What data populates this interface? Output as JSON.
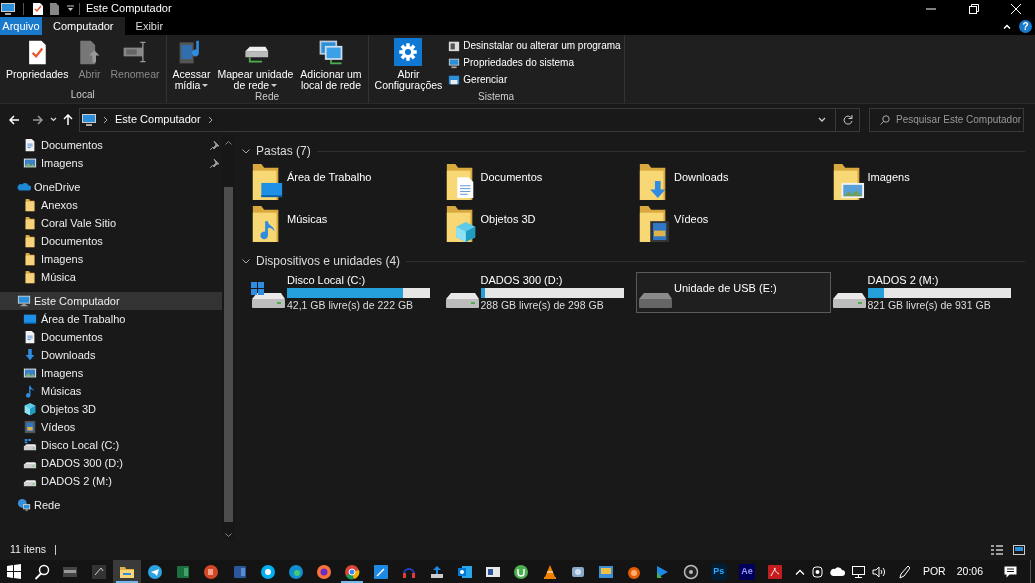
{
  "window": {
    "title": "Este Computador",
    "help": "?"
  },
  "tabs": [
    {
      "label": "Arquivo",
      "kind": "file",
      "selected": false
    },
    {
      "label": "Computador",
      "kind": "tab",
      "selected": true
    },
    {
      "label": "Exibir",
      "kind": "tab",
      "selected": false
    }
  ],
  "ribbon": {
    "groups": [
      {
        "label": "Local",
        "buttons": [
          {
            "kind": "properties",
            "lines": [
              "Propriedades"
            ],
            "disabled": false,
            "dropdown": false
          },
          {
            "kind": "open",
            "lines": [
              "Abrir"
            ],
            "disabled": true,
            "dropdown": false
          },
          {
            "kind": "rename",
            "lines": [
              "Renomear"
            ],
            "disabled": true,
            "dropdown": false
          }
        ]
      },
      {
        "label": "Rede",
        "buttons": [
          {
            "kind": "media",
            "lines": [
              "Acessar",
              "mídia"
            ],
            "disabled": false,
            "dropdown": true
          },
          {
            "kind": "map-drive",
            "lines": [
              "Mapear unidade",
              "de rede"
            ],
            "disabled": false,
            "dropdown": true
          },
          {
            "kind": "add-location",
            "lines": [
              "Adicionar um",
              "local de rede"
            ],
            "disabled": false,
            "dropdown": false
          }
        ]
      },
      {
        "label": "Sistema",
        "buttons": [
          {
            "kind": "settings",
            "lines": [
              "Abrir",
              "Configurações"
            ],
            "disabled": false,
            "dropdown": false
          }
        ],
        "small_buttons": [
          {
            "kind": "uninstall",
            "label": "Desinstalar ou alterar um programa"
          },
          {
            "kind": "system",
            "label": "Propriedades do sistema"
          },
          {
            "kind": "manage",
            "label": "Gerenciar"
          }
        ]
      }
    ]
  },
  "address": {
    "path": [
      "Este Computador"
    ],
    "search_placeholder": "Pesquisar Este Computador"
  },
  "nav": {
    "quick_access": [
      {
        "kind": "documents",
        "label": "Documentos",
        "pinned": true,
        "selected": false
      },
      {
        "kind": "pictures",
        "label": "Imagens",
        "pinned": true,
        "selected": false
      }
    ],
    "sections": [
      {
        "kind": "onedrive",
        "label": "OneDrive",
        "selected": false,
        "children": [
          {
            "kind": "folder",
            "label": "Anexos",
            "selected": false
          },
          {
            "kind": "folder",
            "label": "Coral Vale Sitio",
            "selected": false
          },
          {
            "kind": "folder",
            "label": "Documentos",
            "selected": false
          },
          {
            "kind": "folder",
            "label": "Imagens",
            "selected": false
          },
          {
            "kind": "folder",
            "label": "Música",
            "selected": false
          }
        ]
      },
      {
        "kind": "computer",
        "label": "Este Computador",
        "selected": true,
        "children": [
          {
            "kind": "desktop",
            "label": "Área de Trabalho",
            "selected": false
          },
          {
            "kind": "documents",
            "label": "Documentos",
            "selected": false
          },
          {
            "kind": "downloads",
            "label": "Downloads",
            "selected": false
          },
          {
            "kind": "pictures",
            "label": "Imagens",
            "selected": false
          },
          {
            "kind": "music",
            "label": "Músicas",
            "selected": false
          },
          {
            "kind": "objects3d",
            "label": "Objetos 3D",
            "selected": false
          },
          {
            "kind": "videos",
            "label": "Vídeos",
            "selected": false
          },
          {
            "kind": "windows-drive",
            "label": "Disco Local (C:)",
            "selected": false
          },
          {
            "kind": "drive",
            "label": "DADOS 300 (D:)",
            "selected": false
          },
          {
            "kind": "drive",
            "label": "DADOS 2 (M:)",
            "selected": false
          }
        ]
      },
      {
        "kind": "network",
        "label": "Rede",
        "selected": false
      }
    ]
  },
  "content": {
    "groups": [
      {
        "title": "Pastas (7)",
        "kind": "folders",
        "expanded": true,
        "items": [
          {
            "kind": "desktop",
            "label": "Área de Trabalho"
          },
          {
            "kind": "documents",
            "label": "Documentos"
          },
          {
            "kind": "downloads",
            "label": "Downloads"
          },
          {
            "kind": "pictures",
            "label": "Imagens"
          },
          {
            "kind": "music",
            "label": "Músicas"
          },
          {
            "kind": "objects3d",
            "label": "Objetos 3D"
          },
          {
            "kind": "videos",
            "label": "Vídeos"
          }
        ]
      },
      {
        "title": "Dispositivos e unidades (4)",
        "kind": "drives",
        "expanded": true,
        "items": [
          {
            "kind": "windows-drive",
            "label": "Disco Local (C:)",
            "level": 0.81,
            "reading": "42,1 GB livre(s) de 222 GB",
            "selected": false
          },
          {
            "kind": "drive",
            "label": "DADOS 300 (D:)",
            "level": 0.034,
            "reading": "288 GB livre(s) de 298 GB",
            "selected": false
          },
          {
            "kind": "usb",
            "label": "Unidade de USB (E:)",
            "selected": true
          },
          {
            "kind": "drive",
            "label": "DADOS 2 (M:)",
            "level": 0.118,
            "reading": "821 GB livre(s) de 931 GB",
            "selected": false
          }
        ]
      }
    ]
  },
  "status_bar": {
    "count": "11 itens"
  },
  "taskbar": {
    "apps": [
      {
        "kind": "start",
        "active": false,
        "running": false
      },
      {
        "kind": "search",
        "active": false,
        "running": false
      },
      {
        "kind": "dark",
        "active": false,
        "running": false
      },
      {
        "kind": "dark2",
        "active": false,
        "running": false
      },
      {
        "kind": "explorer",
        "active": true,
        "running": true
      },
      {
        "kind": "telegram",
        "active": false,
        "running": false
      },
      {
        "kind": "excel",
        "active": false,
        "running": false
      },
      {
        "kind": "powerpoint",
        "active": false,
        "running": false
      },
      {
        "kind": "word",
        "active": false,
        "running": false
      },
      {
        "kind": "skype",
        "active": false,
        "running": false
      },
      {
        "kind": "edge",
        "active": false,
        "running": false
      },
      {
        "kind": "firefox",
        "active": false,
        "running": false
      },
      {
        "kind": "chrome",
        "active": false,
        "running": true
      },
      {
        "kind": "pen",
        "active": false,
        "running": false
      },
      {
        "kind": "headset",
        "active": false,
        "running": false
      },
      {
        "kind": "upload",
        "active": false,
        "running": false
      },
      {
        "kind": "outlook",
        "active": false,
        "running": false
      },
      {
        "kind": "window",
        "active": false,
        "running": false
      },
      {
        "kind": "utorrent",
        "active": false,
        "running": false
      },
      {
        "kind": "vlc",
        "active": false,
        "running": false
      },
      {
        "kind": "photos",
        "active": false,
        "running": false
      },
      {
        "kind": "image",
        "active": false,
        "running": false
      },
      {
        "kind": "orange",
        "active": false,
        "running": false
      },
      {
        "kind": "play",
        "active": false,
        "running": false
      },
      {
        "kind": "obs",
        "active": false,
        "running": false
      },
      {
        "kind": "ps",
        "text": "Ps",
        "active": false,
        "running": false
      },
      {
        "kind": "ae",
        "text": "Ae",
        "active": false,
        "running": false
      },
      {
        "kind": "acrobat",
        "active": false,
        "running": false
      }
    ],
    "language": "POR",
    "time": "20:06"
  }
}
